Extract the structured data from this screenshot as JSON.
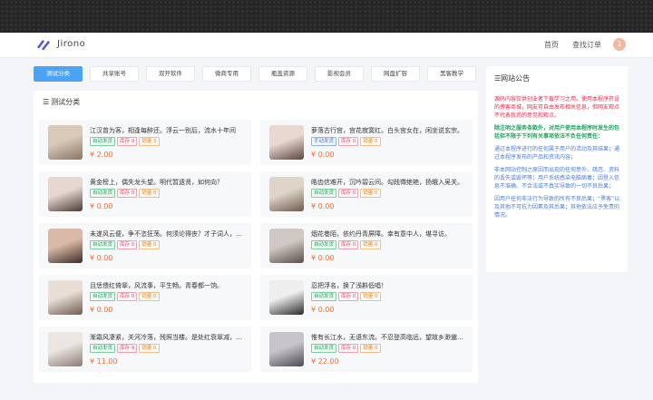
{
  "header": {
    "brand": "Jirono",
    "nav_home": "首页",
    "nav_order": "查找订单",
    "avatar_text": "1"
  },
  "tabs": [
    "测试分类",
    "共享账号",
    "双开软件",
    "微商专用",
    "瓶盖资源",
    "影视会员",
    "网盘扩容",
    "黑客教学"
  ],
  "active_tab": 0,
  "section_title": "测试分类",
  "tag_labels": {
    "auto": "自动发货",
    "manual": "手动发货"
  },
  "products": [
    {
      "title": "江汉曾为客，相逢每醉还。浮云一别后，流水十年间",
      "delivery": "自动发货",
      "stock": "库存 9",
      "sold": "销量 3",
      "price": "¥ 2.00"
    },
    {
      "title": "萝落古行宫，宫花寂寞红。白头宫女在，闲坐说玄宗。",
      "delivery": "手动发货",
      "stock": "库存 0",
      "sold": "销量 0",
      "price": "¥ 0.00"
    },
    {
      "title": "黄金榜上，偶失龙头望。明代暂遗贤，如何向？",
      "delivery": "自动发货",
      "stock": "库存 0",
      "sold": "销量 0",
      "price": "¥ 0.00"
    },
    {
      "title": "皓齿信难开，沉吟碧云间。勾践徵绝艳，扬蛾入吴关。",
      "delivery": "自动发货",
      "stock": "库存 0",
      "sold": "销量 0",
      "price": "¥ 0.00"
    },
    {
      "title": "未遂风云便，争不恣狂荡。何须论得丧？才子词人，自是白衣卿相",
      "delivery": "自动发货",
      "stock": "库存 0",
      "sold": "销量 0",
      "price": "¥ 0.00"
    },
    {
      "title": "烟花巷陌，依约丹青屏障。幸有意中人，堪寻访。",
      "delivery": "自动发货",
      "stock": "库存 0",
      "sold": "销量 0",
      "price": "¥ 0.00"
    },
    {
      "title": "且恁偎红倚翠，风流事，平生畅。青春都一饷。",
      "delivery": "自动发货",
      "stock": "库存 0",
      "sold": "销量 0",
      "price": "¥ 0.00"
    },
    {
      "title": "忍把浮名，换了浅斟低唱！",
      "delivery": "自动发货",
      "stock": "库存 0",
      "sold": "销量 0",
      "price": "¥ 0.00"
    },
    {
      "title": "渐霜风凄紧，关河冷落，残照当楼。是处红衰翠减，苒苒物华休。",
      "delivery": "自动发货",
      "stock": "库存 9",
      "sold": "销量 0",
      "price": "¥ 11.00"
    },
    {
      "title": "惟有长江水，无语东流。不忍登高临远，望故乡渺邈，归思难收。",
      "delivery": "自动发货",
      "stock": "库存 0",
      "sold": "销量 0",
      "price": "¥ 22.00"
    }
  ],
  "notice": {
    "title": "网站公告",
    "red": "源码内容仅供创业者下载学习之用。使用本程序开设的博客商城，网友可自由发布相关信息，但网友观点不代表我司的意见和观点。",
    "green": "除注明之服务条款外，对用户使用本程序时发生的包括但不限于下列有关事项依法不负任何责任：",
    "blue": [
      "通过本程序进行的任何属于用户的活动及其结果；通过本程序发布的产品和资讯内容；",
      "非本网站控制之原因而出现的任何意外、疏忽、资料的丢失或毁坏等；用户系统感染电脑病毒；因登入信息不准确、不合法或不真实导致的一切不良后果；",
      "因用户任何非法行为导致的所有不良后果；“黑客”以及其他不可抗力因素及其后果；其他依法应予免责的情况。"
    ]
  },
  "colors": {
    "accent": "#4ba3f5",
    "price": "#ff6a2e",
    "notice_red": "#e5294a",
    "notice_green": "#19a55a",
    "notice_blue": "#4b7bd6"
  }
}
